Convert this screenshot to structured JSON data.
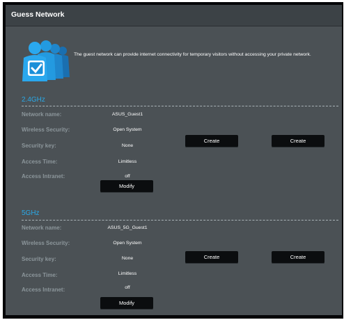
{
  "panel": {
    "title": "Guess Network",
    "description": "The guest network can provide internet connectivity for temporary visitors without accessing your private network."
  },
  "labels": {
    "network_name": "Network name:",
    "wireless_security": "Wireless Security:",
    "security_key": "Security key:",
    "access_time": "Access Time:",
    "access_intranet": "Access Intranet:"
  },
  "bands": [
    {
      "name": "2.4GHz",
      "network_name": "ASUS_Guest1",
      "wireless_security": "Open System",
      "security_key": "None",
      "access_time": "Limitless",
      "access_intranet": "off",
      "buttons": {
        "create_1": "Create",
        "create_2": "Create",
        "modify": "Modify"
      }
    },
    {
      "name": "5GHz",
      "network_name": "ASUS_5G_Guest1",
      "wireless_security": "Open System",
      "security_key": "None",
      "access_time": "Limitless",
      "access_intranet": "off",
      "buttons": {
        "create_1": "Create",
        "create_2": "Create",
        "modify": "Modify"
      }
    }
  ],
  "icon": "guest-users-icon",
  "colors": {
    "accent": "#2aa8e6",
    "panel_bg": "#4b5155",
    "label": "#8c969b",
    "button_bg": "#0b0d0f"
  }
}
